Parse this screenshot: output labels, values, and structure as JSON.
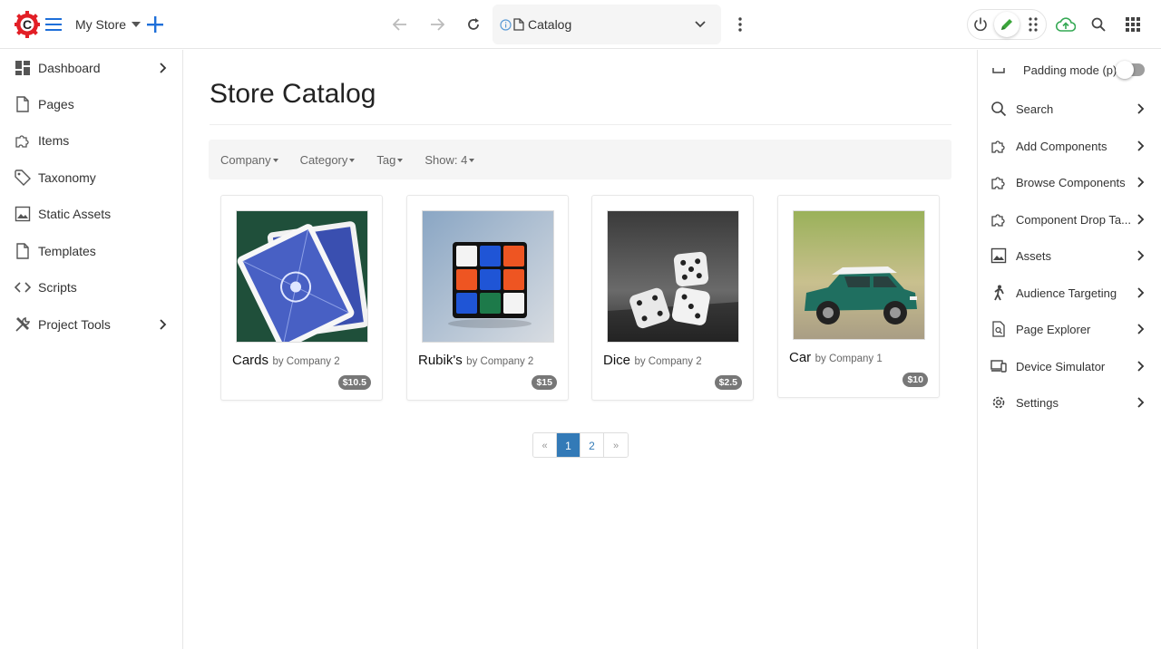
{
  "topbar": {
    "site_name": "My Store",
    "address_label": "Catalog"
  },
  "nav": {
    "items": [
      {
        "label": "Dashboard",
        "icon": "dashboard-icon"
      },
      {
        "label": "Pages",
        "icon": "page-icon"
      },
      {
        "label": "Items",
        "icon": "puzzle-icon"
      },
      {
        "label": "Taxonomy",
        "icon": "tag-icon"
      },
      {
        "label": "Static Assets",
        "icon": "image-icon"
      },
      {
        "label": "Templates",
        "icon": "page-icon"
      },
      {
        "label": "Scripts",
        "icon": "code-icon"
      },
      {
        "label": "Project Tools",
        "icon": "tools-icon"
      }
    ]
  },
  "main": {
    "title": "Store Catalog",
    "filters": [
      "Company",
      "Category",
      "Tag",
      "Show: 4"
    ],
    "products": [
      {
        "name": "Cards",
        "by": "by Company 2",
        "price": "$10.5"
      },
      {
        "name": "Rubik's",
        "by": "by Company 2",
        "price": "$15"
      },
      {
        "name": "Dice",
        "by": "by Company 2",
        "price": "$2.5"
      },
      {
        "name": "Car",
        "by": "by Company 1",
        "price": "$10"
      }
    ],
    "pagination": {
      "prev": "«",
      "pages": [
        "1",
        "2"
      ],
      "next": "»",
      "active": "1"
    }
  },
  "panel": {
    "padding_mode": "Padding mode (p)",
    "items": [
      {
        "label": "Search",
        "icon": "search-icon"
      },
      {
        "label": "Add Components",
        "icon": "puzzle-icon"
      },
      {
        "label": "Browse Components",
        "icon": "puzzle-icon"
      },
      {
        "label": "Component Drop Ta...",
        "icon": "puzzle-icon"
      },
      {
        "label": "Assets",
        "icon": "image-icon"
      },
      {
        "label": "Audience Targeting",
        "icon": "person-icon"
      },
      {
        "label": "Page Explorer",
        "icon": "page-search-icon"
      },
      {
        "label": "Device Simulator",
        "icon": "devices-icon"
      },
      {
        "label": "Settings",
        "icon": "gear-icon"
      }
    ]
  },
  "colors": {
    "brand_red": "#e21f26",
    "accent_blue": "#1e6fd9",
    "publish_green": "#34a853",
    "edit_green": "#3aa53a",
    "pager_blue": "#337ab7"
  }
}
